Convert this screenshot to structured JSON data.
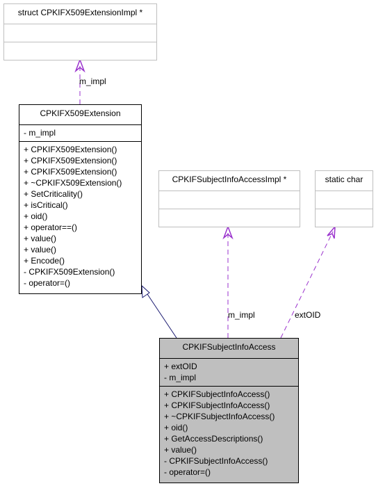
{
  "diagram": {
    "nodes": {
      "ext_impl": {
        "title": "struct CPKIFX509ExtensionImpl *",
        "attributes": [],
        "methods": []
      },
      "x509ext": {
        "title": "CPKIFX509Extension",
        "attributes": [
          "- m_impl"
        ],
        "methods": [
          "+ CPKIFX509Extension()",
          "+ CPKIFX509Extension()",
          "+ CPKIFX509Extension()",
          "+ ~CPKIFX509Extension()",
          "+ SetCriticality()",
          "+ isCritical()",
          "+ oid()",
          "+ operator==()",
          "+ value()",
          "+ value()",
          "+ Encode()",
          "- CPKIFX509Extension()",
          "- operator=()"
        ]
      },
      "sia_impl": {
        "title": "CPKIFSubjectInfoAccessImpl *",
        "attributes": [],
        "methods": []
      },
      "static_char": {
        "title": "static char",
        "attributes": [],
        "methods": []
      },
      "sia": {
        "title": "CPKIFSubjectInfoAccess",
        "attributes": [
          "+ extOID",
          "- m_impl"
        ],
        "methods": [
          "+ CPKIFSubjectInfoAccess()",
          "+ CPKIFSubjectInfoAccess()",
          "+ ~CPKIFSubjectInfoAccess()",
          "+ oid()",
          "+ GetAccessDescriptions()",
          "+ value()",
          "- CPKIFSubjectInfoAccess()",
          "- operator=()"
        ]
      }
    },
    "edges": {
      "x509ext_impl": {
        "label": "m_impl",
        "type": "usage"
      },
      "sia_impl": {
        "label": "m_impl",
        "type": "usage"
      },
      "sia_extoid": {
        "label": "extOID",
        "type": "usage"
      },
      "inheritance": {
        "label": "",
        "type": "inheritance"
      }
    },
    "colors": {
      "usage_edge": "#9a32cd",
      "inheritance_edge": "#191970",
      "highlight_fill": "#bfbfbf",
      "external_border": "#bfbfbf"
    }
  }
}
